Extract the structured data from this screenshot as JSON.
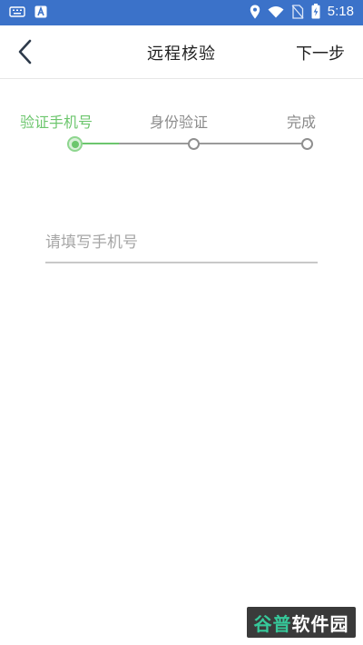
{
  "status_bar": {
    "time": "5:18",
    "icons": [
      "keyboard-icon",
      "notification-a-icon",
      "location-icon",
      "wifi-icon",
      "no-sim-icon",
      "battery-charging-icon"
    ]
  },
  "nav": {
    "back_icon": "chevron-left-icon",
    "title": "远程核验",
    "next_label": "下一步"
  },
  "stepper": {
    "steps": [
      {
        "label": "验证手机号",
        "state": "active"
      },
      {
        "label": "身份验证",
        "state": "pending"
      },
      {
        "label": "完成",
        "state": "pending"
      }
    ],
    "active_color": "#6cc66d",
    "inactive_color": "#8a8a8a"
  },
  "phone": {
    "value": "",
    "placeholder": "请填写手机号"
  },
  "watermark": {
    "brand_part1": "谷普",
    "brand_part2": "软件园"
  },
  "colors": {
    "status_bar": "#3b72c9",
    "accent_green": "#6cc66d"
  }
}
